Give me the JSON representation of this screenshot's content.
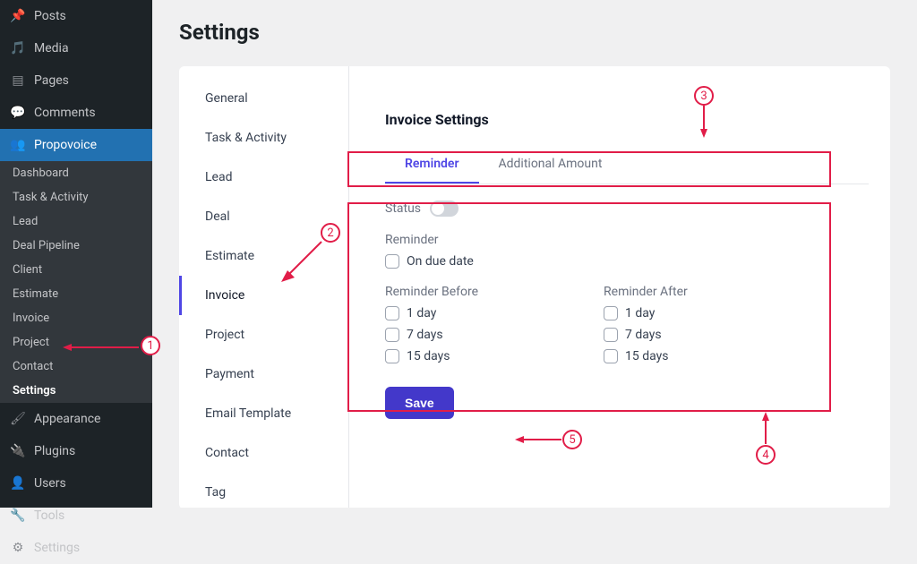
{
  "page": {
    "title": "Settings"
  },
  "wp_menu": {
    "items": [
      {
        "label": "Posts",
        "icon": "pin"
      },
      {
        "label": "Media",
        "icon": "media"
      },
      {
        "label": "Pages",
        "icon": "page"
      },
      {
        "label": "Comments",
        "icon": "comment"
      },
      {
        "label": "Propovoice",
        "icon": "users",
        "highlight": true
      }
    ],
    "sub_items": [
      {
        "label": "Dashboard"
      },
      {
        "label": "Task & Activity"
      },
      {
        "label": "Lead"
      },
      {
        "label": "Deal Pipeline"
      },
      {
        "label": "Client"
      },
      {
        "label": "Estimate"
      },
      {
        "label": "Invoice"
      },
      {
        "label": "Project"
      },
      {
        "label": "Contact"
      },
      {
        "label": "Settings",
        "bold": true
      }
    ],
    "items_after": [
      {
        "label": "Appearance",
        "icon": "brush"
      },
      {
        "label": "Plugins",
        "icon": "plug"
      },
      {
        "label": "Users",
        "icon": "user"
      },
      {
        "label": "Tools",
        "icon": "wrench"
      },
      {
        "label": "Settings",
        "icon": "cog"
      }
    ]
  },
  "settings_tabs": [
    {
      "label": "General"
    },
    {
      "label": "Task & Activity"
    },
    {
      "label": "Lead"
    },
    {
      "label": "Deal"
    },
    {
      "label": "Estimate"
    },
    {
      "label": "Invoice",
      "active": true
    },
    {
      "label": "Project"
    },
    {
      "label": "Payment"
    },
    {
      "label": "Email Template"
    },
    {
      "label": "Contact"
    },
    {
      "label": "Tag"
    }
  ],
  "invoice": {
    "heading": "Invoice Settings",
    "subtabs": [
      {
        "label": "Reminder",
        "active": true
      },
      {
        "label": "Additional Amount"
      }
    ],
    "status_label": "Status",
    "reminder_label": "Reminder",
    "on_due_label": "On due date",
    "before": {
      "title": "Reminder Before",
      "options": [
        "1 day",
        "7 days",
        "15 days"
      ]
    },
    "after": {
      "title": "Reminder After",
      "options": [
        "1 day",
        "7 days",
        "15 days"
      ]
    },
    "save_label": "Save"
  },
  "annotations": {
    "n1": "1",
    "n2": "2",
    "n3": "3",
    "n4": "4",
    "n5": "5"
  }
}
